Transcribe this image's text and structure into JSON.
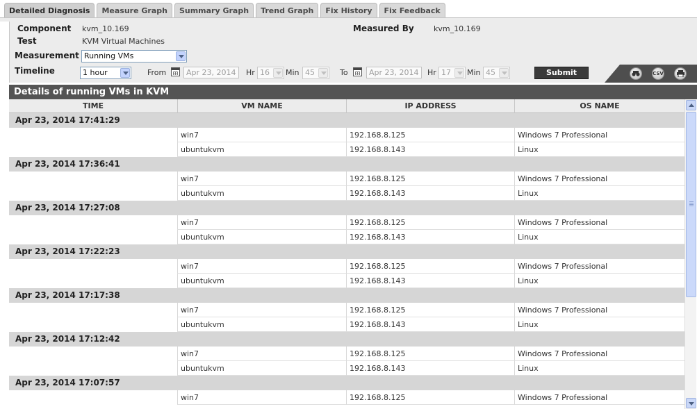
{
  "tabs": [
    "Detailed Diagnosis",
    "Measure Graph",
    "Summary Graph",
    "Trend Graph",
    "Fix History",
    "Fix Feedback"
  ],
  "filters": {
    "component_label": "Component",
    "component_value": "kvm_10.169",
    "test_label": "Test",
    "test_value": "KVM Virtual Machines",
    "measured_by_label": "Measured By",
    "measured_by_value": "kvm_10.169",
    "measurement_label": "Measurement",
    "measurement_value": "Running VMs",
    "timeline_label": "Timeline",
    "timeline_value": "1 hour",
    "from_label": "From",
    "from_date": "Apr 23, 2014",
    "from_hr_label": "Hr",
    "from_hr": "16",
    "from_min_label": "Min",
    "from_min": "45",
    "to_label": "To",
    "to_date": "Apr 23, 2014",
    "to_hr_label": "Hr",
    "to_hr": "17",
    "to_min_label": "Min",
    "to_min": "45",
    "submit_label": "Submit"
  },
  "toolbar_icons": [
    "binoculars-icon",
    "csv-icon",
    "print-icon"
  ],
  "toolbar_csv_text": "CSV",
  "section_title": "Details of running VMs in KVM",
  "columns": [
    "TIME",
    "VM NAME",
    "IP ADDRESS",
    "OS NAME"
  ],
  "groups": [
    {
      "time": "Apr 23, 2014 17:41:29",
      "rows": [
        [
          "win7",
          "192.168.8.125",
          "Windows 7 Professional"
        ],
        [
          "ubuntukvm",
          "192.168.8.143",
          "Linux"
        ]
      ]
    },
    {
      "time": "Apr 23, 2014 17:36:41",
      "rows": [
        [
          "win7",
          "192.168.8.125",
          "Windows 7 Professional"
        ],
        [
          "ubuntukvm",
          "192.168.8.143",
          "Linux"
        ]
      ]
    },
    {
      "time": "Apr 23, 2014 17:27:08",
      "rows": [
        [
          "win7",
          "192.168.8.125",
          "Windows 7 Professional"
        ],
        [
          "ubuntukvm",
          "192.168.8.143",
          "Linux"
        ]
      ]
    },
    {
      "time": "Apr 23, 2014 17:22:23",
      "rows": [
        [
          "win7",
          "192.168.8.125",
          "Windows 7 Professional"
        ],
        [
          "ubuntukvm",
          "192.168.8.143",
          "Linux"
        ]
      ]
    },
    {
      "time": "Apr 23, 2014 17:17:38",
      "rows": [
        [
          "win7",
          "192.168.8.125",
          "Windows 7 Professional"
        ],
        [
          "ubuntukvm",
          "192.168.8.143",
          "Linux"
        ]
      ]
    },
    {
      "time": "Apr 23, 2014 17:12:42",
      "rows": [
        [
          "win7",
          "192.168.8.125",
          "Windows 7 Professional"
        ],
        [
          "ubuntukvm",
          "192.168.8.143",
          "Linux"
        ]
      ]
    },
    {
      "time": "Apr 23, 2014 17:07:57",
      "rows": [
        [
          "win7",
          "192.168.8.125",
          "Windows 7 Professional"
        ]
      ]
    }
  ]
}
